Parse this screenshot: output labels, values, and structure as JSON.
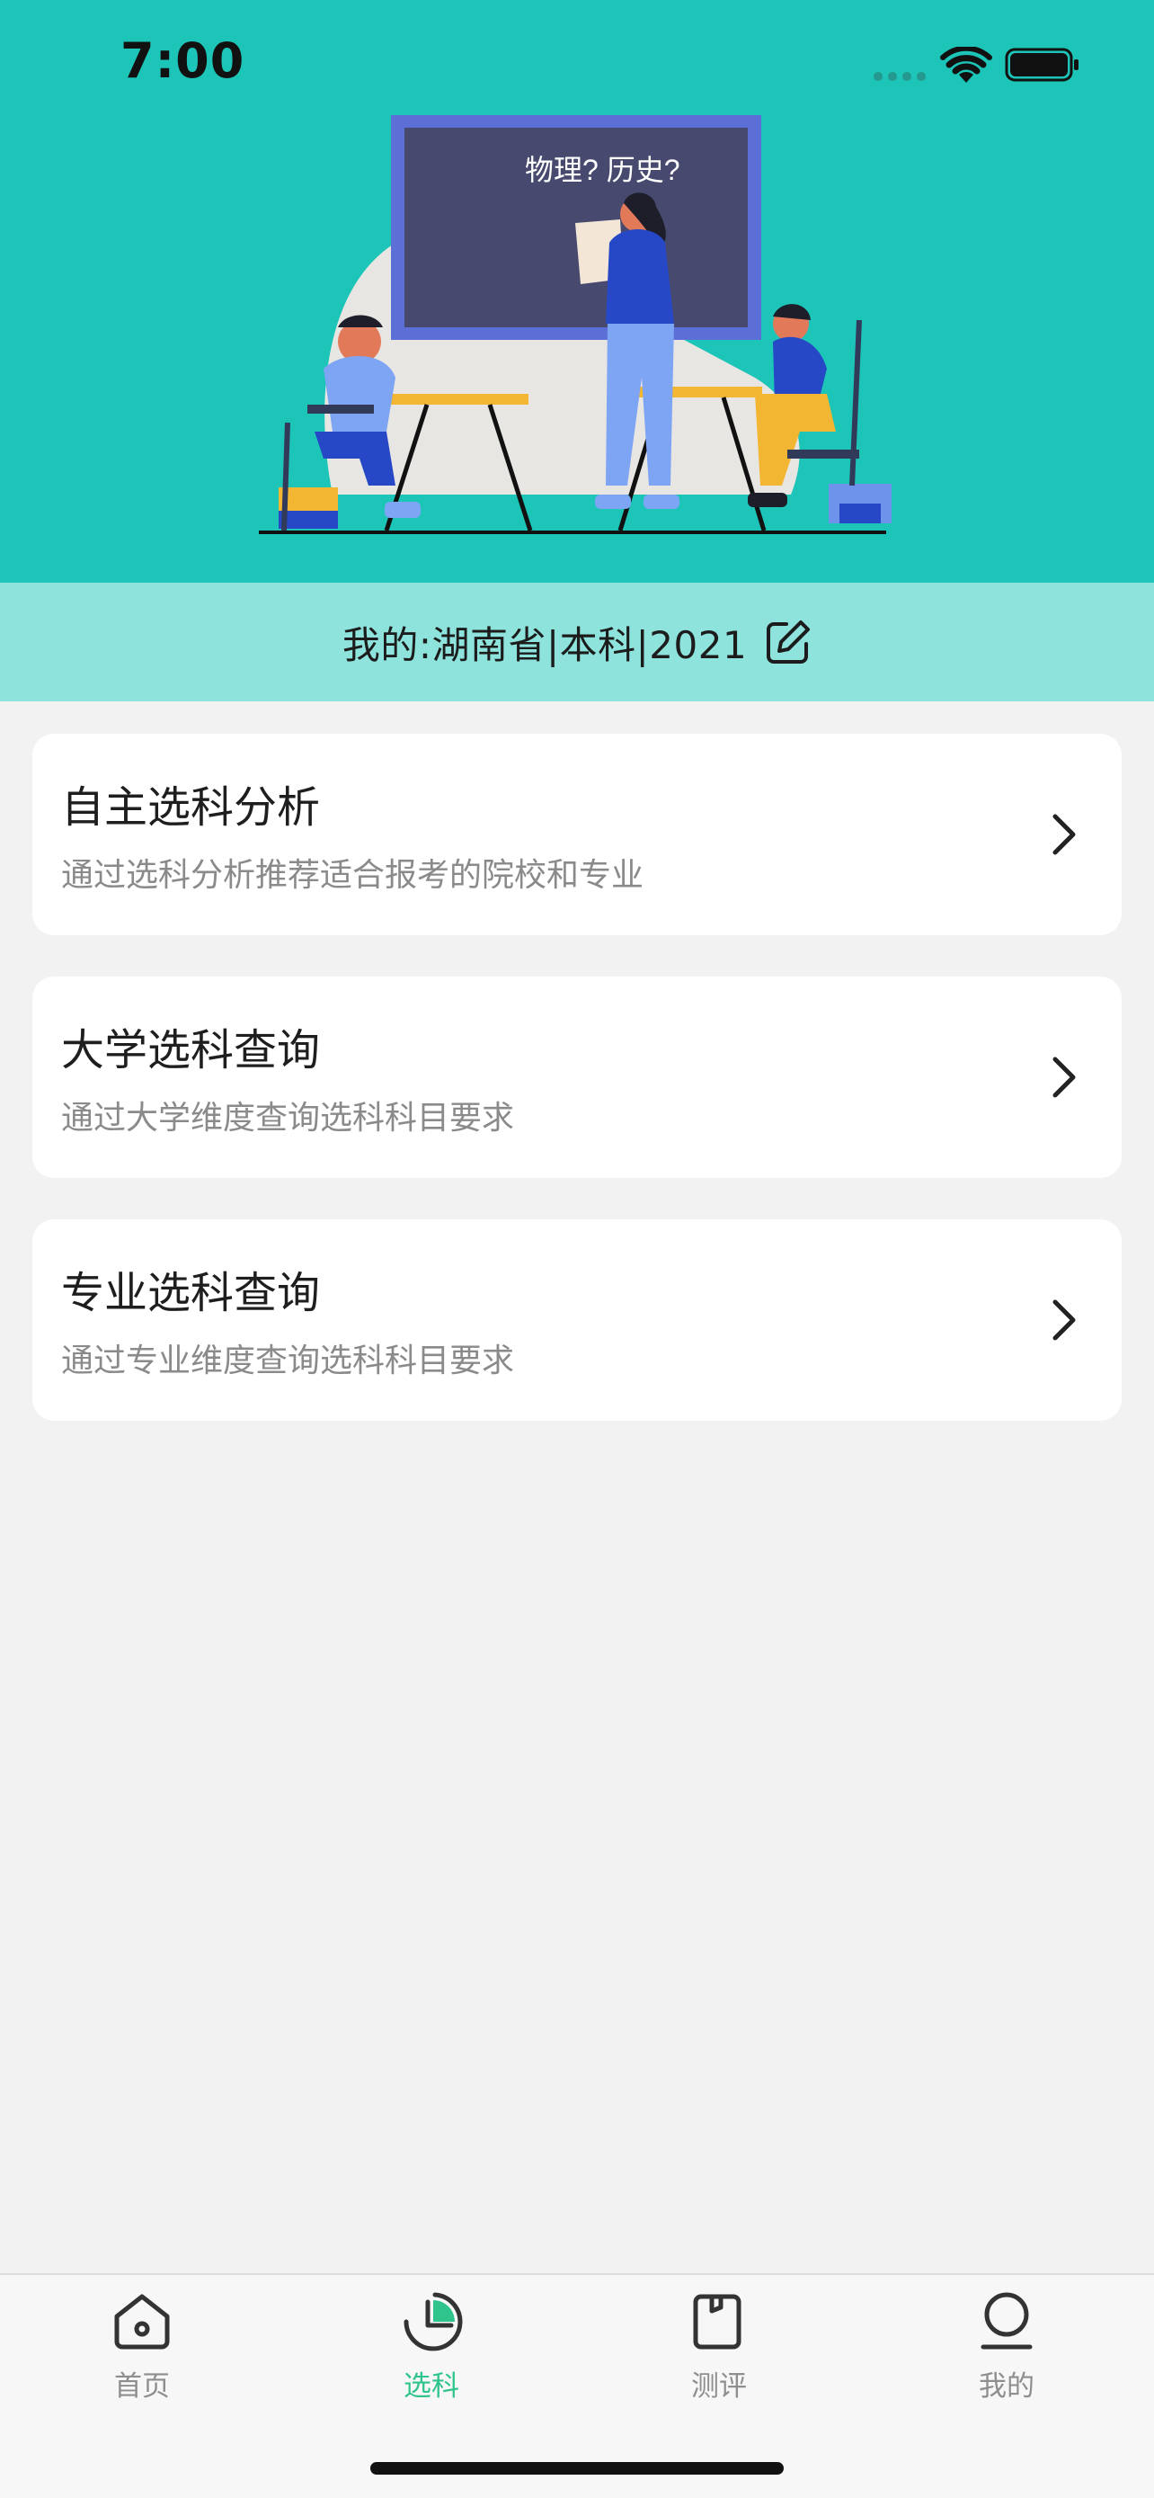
{
  "status_bar": {
    "time": "7:00"
  },
  "hero": {
    "board_text": "物理?   历史?"
  },
  "profile": {
    "text": "我的:湖南省|本科|2021"
  },
  "cards": [
    {
      "title": "自主选科分析",
      "subtitle": "通过选科分析推荐适合报考的院校和专业"
    },
    {
      "title": "大学选科查询",
      "subtitle": "通过大学维度查询选科科目要求"
    },
    {
      "title": "专业选科查询",
      "subtitle": "通过专业维度查询选科科目要求"
    }
  ],
  "tabbar": {
    "items": [
      {
        "label": "首页",
        "icon": "home-icon"
      },
      {
        "label": "选科",
        "icon": "pie-chart-icon",
        "active": true
      },
      {
        "label": "测评",
        "icon": "document-icon"
      },
      {
        "label": "我的",
        "icon": "user-icon"
      }
    ]
  },
  "colors": {
    "hero_bg": "#1cc5b7",
    "profile_bg": "#8ee3dd",
    "active_tab": "#2fc48c",
    "page_bg": "#f2f2f2"
  }
}
